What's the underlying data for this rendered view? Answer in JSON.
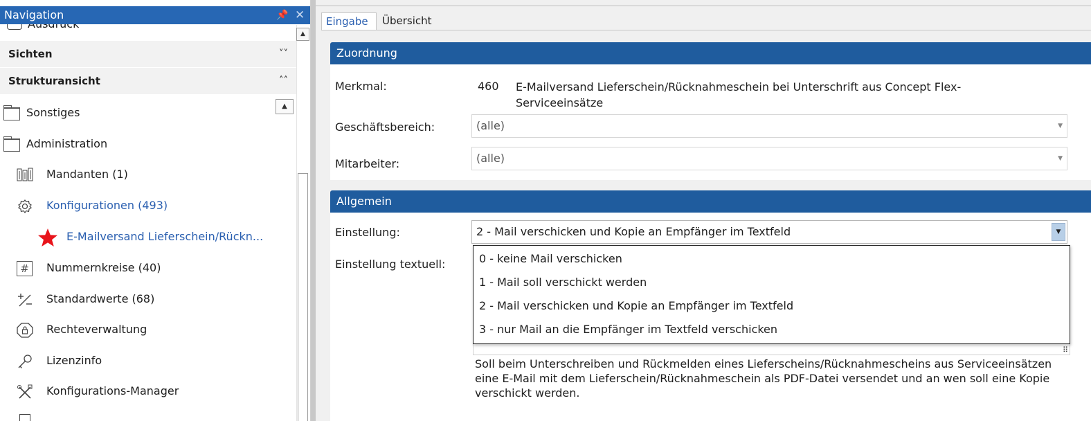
{
  "nav": {
    "title": "Navigation",
    "pin_glyph": "📌",
    "close_glyph": "✕",
    "top_item_label": "Ausdruck",
    "sections": [
      {
        "label": "Sichten",
        "chevron": "˅˅"
      },
      {
        "label": "Strukturansicht",
        "chevron": "˄˄"
      }
    ],
    "tree": {
      "sonstiges": "Sonstiges",
      "administration": "Administration",
      "mandanten": "Mandanten (1)",
      "konfigurationen": "Konfigurationen (493)",
      "email_item": "E-Mailversand Lieferschein/Rückn...",
      "nummernkreise": "Nummernkreise (40)",
      "standardwerte": "Standardwerte (68)",
      "rechteverwaltung": "Rechteverwaltung",
      "lizenzinfo": "Lizenzinfo",
      "konfigurations_manager": "Konfigurations-Manager"
    },
    "icons": {
      "mandanten": "building-icon",
      "konfigurationen": "gear-icon",
      "email_item": "star-icon",
      "nummernkreise": "hash-icon",
      "standardwerte": "plus-minus-icon",
      "rechteverwaltung": "shield-lock-icon",
      "lizenzinfo": "key-icon",
      "konfigurations_manager": "tools-icon"
    },
    "star_color": "#e8141b"
  },
  "tabs": {
    "eingabe": "Eingabe",
    "uebersicht": "Übersicht"
  },
  "zuordnung": {
    "header": "Zuordnung",
    "merkmal_label": "Merkmal:",
    "merkmal_number": "460",
    "merkmal_text": "E-Mailversand Lieferschein/Rücknahmeschein bei Unterschrift aus Concept Flex-Serviceeinsätze",
    "geschaeftsbereich_label": "Geschäftsbereich:",
    "geschaeftsbereich_value": "(alle)",
    "mitarbeiter_label": "Mitarbeiter:",
    "mitarbeiter_value": "(alle)"
  },
  "allgemein": {
    "header": "Allgemein",
    "einstellung_label": "Einstellung:",
    "einstellung_value": "2 - Mail verschicken und Kopie an Empfänger im Textfeld",
    "einstellung_textuell_label": "Einstellung textuell:",
    "options": [
      "0 - keine Mail verschicken",
      "1 - Mail soll verschickt werden",
      "2 - Mail verschicken und Kopie an Empfänger im Textfeld",
      "3 - nur Mail an die Empfänger im Textfeld verschicken"
    ],
    "hint": "Soll beim Unterschreiben und Rückmelden eines Lieferscheins/Rücknahmescheins aus Serviceeinsätzen eine E-Mail mit dem Lieferschein/Rücknahmeschein als PDF-Datei versendet und an wen soll eine Kopie verschickt werden."
  },
  "colors": {
    "nav_title_bg": "#2767b4",
    "group_header_bg": "#1f5c9e",
    "selected_text": "#2a5fb0"
  }
}
